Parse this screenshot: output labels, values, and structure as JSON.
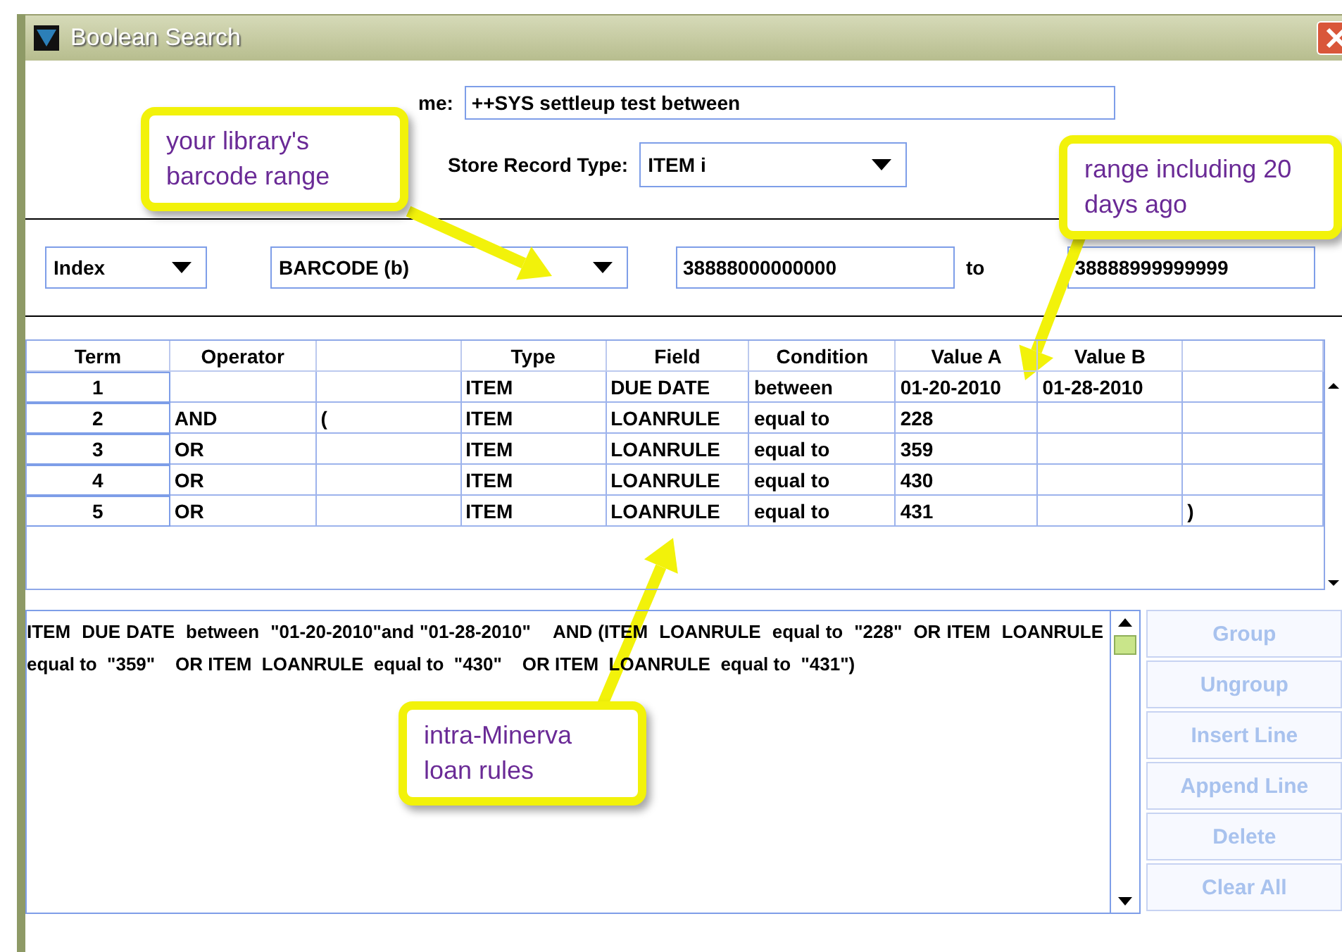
{
  "window": {
    "title": "Boolean Search"
  },
  "name": {
    "label": "me:",
    "value": "++SYS settleup test between"
  },
  "store_record_type": {
    "label": "Store Record Type:",
    "value": "ITEM i"
  },
  "range": {
    "index": "Index",
    "field": "BARCODE  (b)",
    "from": "38888000000000",
    "to_label": "to",
    "to": "38888999999999"
  },
  "table": {
    "columns": {
      "term": "Term",
      "operator": "Operator",
      "type": "Type",
      "field": "Field",
      "condition": "Condition",
      "value_a": "Value A",
      "value_b": "Value B"
    },
    "rows": [
      {
        "term": "1",
        "type": "ITEM",
        "field": "DUE DATE",
        "condition": "between",
        "value_a": "01-20-2010",
        "value_b": "01-28-2010"
      },
      {
        "term": "2",
        "operator": "AND",
        "open": "(",
        "type": "ITEM",
        "field": "LOANRULE",
        "condition": "equal to",
        "value_a": "228"
      },
      {
        "term": "3",
        "operator": "OR",
        "type": "ITEM",
        "field": "LOANRULE",
        "condition": "equal to",
        "value_a": "359"
      },
      {
        "term": "4",
        "operator": "OR",
        "type": "ITEM",
        "field": "LOANRULE",
        "condition": "equal to",
        "value_a": "430"
      },
      {
        "term": "5",
        "operator": "OR",
        "type": "ITEM",
        "field": "LOANRULE",
        "condition": "equal to",
        "value_a": "431",
        "close": ")"
      }
    ]
  },
  "query_text": "ITEM  DUE DATE  between  \"01-20-2010\"and \"01-28-2010\"    AND (ITEM  LOANRULE  equal to  \"228\"  OR ITEM  LOANRULE  equal to  \"359\"    OR ITEM  LOANRULE  equal to  \"430\"    OR ITEM  LOANRULE  equal to  \"431\")",
  "buttons": [
    {
      "label": "Group",
      "disabled": true
    },
    {
      "label": "Ungroup",
      "disabled": true
    },
    {
      "label": "Insert Line",
      "disabled": true
    },
    {
      "label": "Append Line",
      "disabled": true
    },
    {
      "label": "Delete",
      "disabled": true
    },
    {
      "label": "Clear All",
      "disabled": true
    }
  ],
  "callouts": [
    {
      "text": "your library's barcode range"
    },
    {
      "text": "range including 20 days ago"
    },
    {
      "text": "intra-Minerva loan rules"
    }
  ]
}
